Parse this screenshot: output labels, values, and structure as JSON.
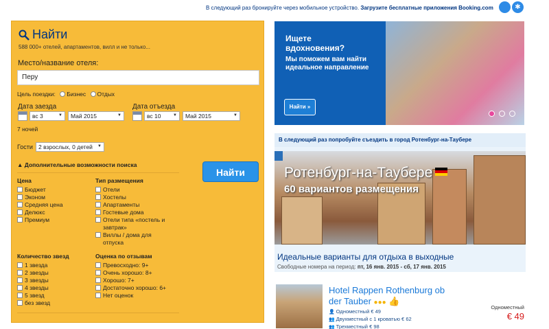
{
  "topbar": {
    "message": "В следующий раз бронируйте через мобильное устройство.",
    "link": "Загрузите бесплатные приложения Booking.com",
    "apple_icon": "apple-icon",
    "android_icon": "android-icon"
  },
  "search": {
    "title": "Найти",
    "subtitle": "588 000+ отелей, апартаментов, вилл и не только...",
    "destination_label": "Место/название отеля:",
    "destination_value": "Перу",
    "trip_purpose_label": "Цель поездки:",
    "trip_purpose_options": [
      "Бизнес",
      "Отдых"
    ],
    "checkin_label": "Дата заезда",
    "checkin_day": "вс 3",
    "checkin_month": "Май 2015",
    "checkout_label": "Дата отъезда",
    "checkout_day": "вс 10",
    "checkout_month": "Май 2015",
    "nights": "7 ночей",
    "guests_label": "Гости",
    "guests_value": "2 взрослых, 0 детей",
    "more_options": "Дополнительные возможности поиска",
    "submit": "Найти",
    "price_heading": "Цена",
    "price_options": [
      "Бюджет",
      "Эконом",
      "Средняя цена",
      "Делюкс",
      "Премиум"
    ],
    "type_heading": "Тип размещения",
    "type_options": [
      "Отели",
      "Хостелы",
      "Апартаменты",
      "Гостевые дома",
      "Отели типа «постель и",
      "завтрак»",
      "Виллы / дома для",
      "отпуска"
    ],
    "stars_heading": "Количество звезд",
    "stars_options": [
      "1 звезда",
      "2 звезды",
      "3 звезды",
      "4 звезды",
      "5 звезд",
      "без звезд"
    ],
    "review_heading": "Оценка по отзывам",
    "review_options": [
      "Превосходно: 9+",
      "Очень хорошо: 8+",
      "Хорошо: 7+",
      "Достаточно хорошо: 6+",
      "Нет оценок"
    ]
  },
  "banner": {
    "headline": "Ищете вдохновения?",
    "text": "Мы поможем вам найти идеальное направление",
    "button": "Найти »"
  },
  "promo": {
    "bar_text": "В следующий раз попробуйте съездить в город Ротенбург-на-Таубере",
    "city": "Ротенбург-на-Таубере",
    "count": "60 вариантов размещения",
    "info": "Идеальные варианты для отдыха в выходные",
    "period_label": "Свободные номера на период:",
    "period_value": "пт, 16 янв. 2015 - сб, 17 янв. 2015"
  },
  "hotel": {
    "name": "Hotel Rappen Rothenburg ob der Tauber",
    "stars": "●●●",
    "thumb_icon": "thumbs-up-icon",
    "room_single": "Одноместный € 49",
    "room_double": "Двухместный с 1 кроватью € 62",
    "room_triple": "Трехместный € 98",
    "price_type": "Одноместный",
    "price": "€ 49"
  }
}
